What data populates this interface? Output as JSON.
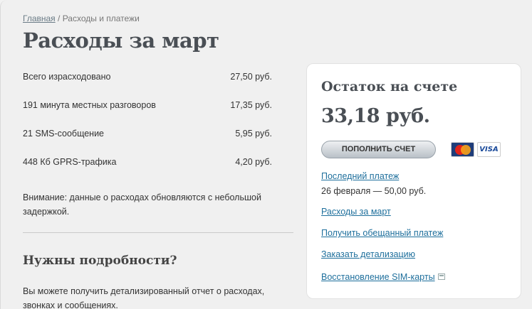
{
  "breadcrumb": {
    "home": "Главная",
    "separator": " / ",
    "current": "Расходы и платежи"
  },
  "page_title": "Расходы за март",
  "expenses": [
    {
      "label": "Всего израсходовано",
      "value": "27,50 руб."
    },
    {
      "label": "191 минута местных разговоров",
      "value": "17,35 руб."
    },
    {
      "label": "21 SMS-сообщение",
      "value": "5,95 руб."
    },
    {
      "label": "448 Кб GPRS-трафика",
      "value": "4,20 руб."
    }
  ],
  "notice": "Внимание: данные о расходах обновляются с небольшой задержкой.",
  "details": {
    "title": "Нужны подробности?",
    "text": "Вы можете получить детализированный отчет о расходах, звонках и сообщениях."
  },
  "balance_card": {
    "title": "Остаток на счете",
    "amount": "33,18 руб.",
    "topup_label": "ПОПОЛНИТЬ СЧЕТ",
    "payment_icons": [
      "mastercard-icon",
      "visa-icon"
    ],
    "visa_text": "VISA",
    "last_payment_link": "Последний платеж",
    "last_payment_text": "26 февраля — 50,00 руб.",
    "links": [
      "Расходы за март",
      "Получить обещанный платеж",
      "Заказать детализацию",
      "Восстановление SIM-карты"
    ]
  },
  "colors": {
    "link": "#1e6f9c",
    "title": "#4a4f55",
    "background": "#f0f0f0",
    "card": "#ffffff"
  }
}
